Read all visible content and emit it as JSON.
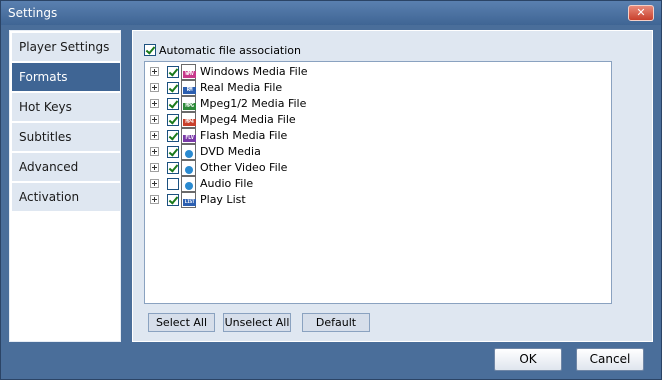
{
  "window": {
    "title": "Settings"
  },
  "nav": {
    "items": [
      {
        "label": "Player Settings",
        "active": false
      },
      {
        "label": "Formats",
        "active": true
      },
      {
        "label": "Hot Keys",
        "active": false
      },
      {
        "label": "Subtitles",
        "active": false
      },
      {
        "label": "Advanced",
        "active": false
      },
      {
        "label": "Activation",
        "active": false
      }
    ]
  },
  "formats": {
    "auto_association": {
      "label": "Automatic file association",
      "checked": true
    },
    "items": [
      {
        "label": "Windows Media File",
        "checked": true,
        "icon": "wmv-file-icon",
        "tag": "WMV",
        "tag_color": "#c83a8c"
      },
      {
        "label": "Real Media File",
        "checked": true,
        "icon": "rm-file-icon",
        "tag": "RM",
        "tag_color": "#2c5fb0"
      },
      {
        "label": "Mpeg1/2 Media File",
        "checked": true,
        "icon": "mpeg-file-icon",
        "tag": "MPG",
        "tag_color": "#2e8a3a"
      },
      {
        "label": "Mpeg4 Media File",
        "checked": true,
        "icon": "mp4-file-icon",
        "tag": "MP4",
        "tag_color": "#c8402c"
      },
      {
        "label": "Flash Media File",
        "checked": true,
        "icon": "flv-file-icon",
        "tag": "FLV",
        "tag_color": "#7a3aa8"
      },
      {
        "label": "DVD Media",
        "checked": true,
        "icon": "dvd-file-icon",
        "tag": "",
        "tag_color": "#2a8ad0"
      },
      {
        "label": "Other Video File",
        "checked": true,
        "icon": "video-file-icon",
        "tag": "",
        "tag_color": "#2a8ad0"
      },
      {
        "label": "Audio File",
        "checked": false,
        "icon": "audio-file-icon",
        "tag": "",
        "tag_color": "#2a8ad0"
      },
      {
        "label": "Play List",
        "checked": true,
        "icon": "playlist-file-icon",
        "tag": "LIST",
        "tag_color": "#2c5fb0"
      }
    ],
    "buttons": {
      "select_all": "Select All",
      "unselect_all": "Unselect All",
      "default": "Default"
    }
  },
  "footer": {
    "ok": "OK",
    "cancel": "Cancel"
  },
  "colors": {
    "accent": "#3f6594",
    "window_bg": "#4a6e9a",
    "panel_bg": "#dfe7f1",
    "close": "#c8402c"
  }
}
